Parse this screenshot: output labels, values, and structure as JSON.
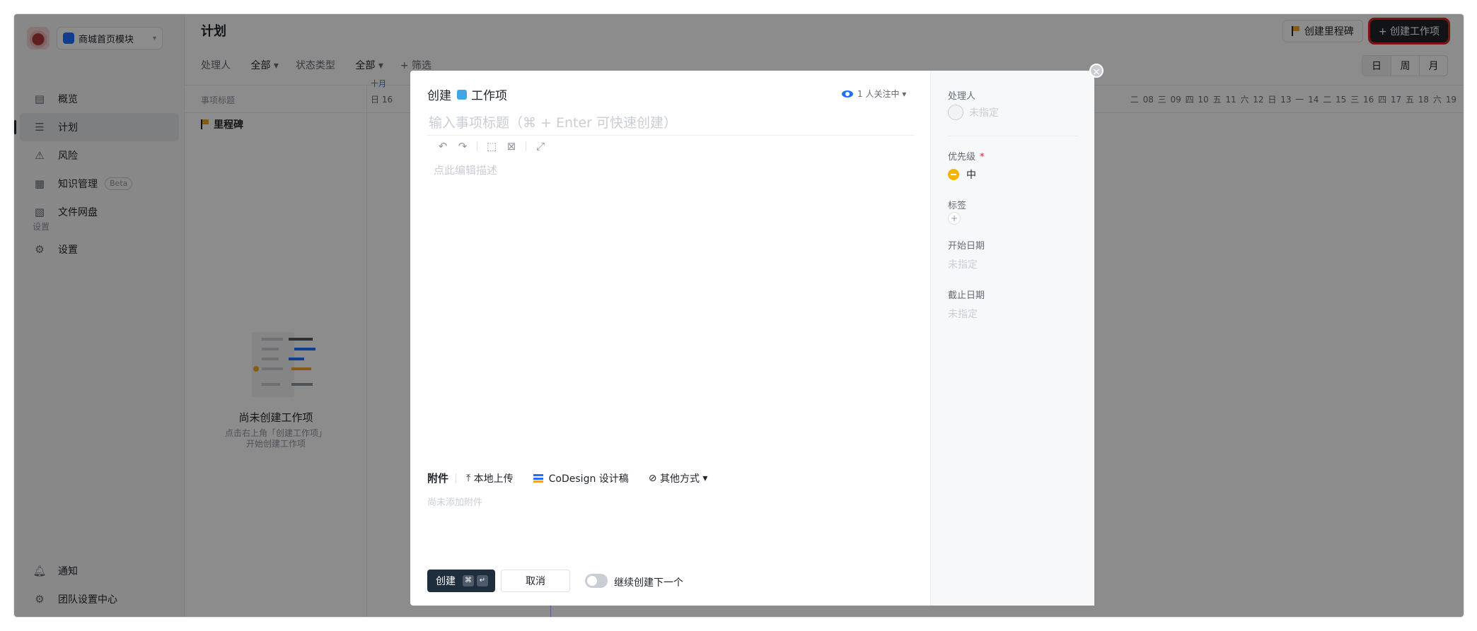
{
  "sidebar": {
    "project_name": "商城首页模块",
    "items": [
      {
        "label": "概览",
        "icon": "overview-icon"
      },
      {
        "label": "计划",
        "icon": "plan-icon"
      },
      {
        "label": "风险",
        "icon": "risk-icon"
      },
      {
        "label": "知识管理",
        "icon": "knowledge-icon",
        "badge": "Beta"
      },
      {
        "label": "文件网盘",
        "icon": "drive-icon"
      }
    ],
    "section_label": "设置",
    "settings_label": "设置",
    "notify_label": "通知",
    "team_settings_label": "团队设置中心"
  },
  "main": {
    "page_title": "计划",
    "create_milestone_label": "创建里程碑",
    "create_work_item_label": "+ 创建工作项",
    "filters": {
      "assignee_label": "处理人",
      "assignee_value": "全部",
      "status_label": "状态类型",
      "status_value": "全部",
      "more_label": "+ 筛选"
    },
    "view_toggle": [
      "日",
      "周",
      "月"
    ],
    "column_title": "事项标题",
    "month_label": "十月",
    "first_day": "日 16",
    "days_right": [
      "二 08",
      "三 09",
      "四 10",
      "五 11",
      "六 12",
      "日 13",
      "一 14",
      "二 15",
      "三 16",
      "四 17",
      "五 18",
      "六 19"
    ],
    "milestone_label": "里程碑",
    "empty_title": "尚未创建工作项",
    "empty_desc": "点击右上角「创建工作项」开始创建工作项"
  },
  "modal": {
    "title_prefix": "创建",
    "title_type": "工作项",
    "watching": "1 人关注中",
    "title_placeholder": "输入事项标题（⌘ + Enter 可快速创建）",
    "desc_placeholder": "点此编辑描述",
    "attach_label": "附件",
    "attach_local": "本地上传",
    "attach_codesign": "CoDesign 设计稿",
    "attach_other": "其他方式",
    "attach_empty": "尚未添加附件",
    "create_label": "创建",
    "cancel_label": "取消",
    "continue_label": "继续创建下一个",
    "props": {
      "assignee_label": "处理人",
      "assignee_value": "未指定",
      "priority_label": "优先级",
      "priority_required": "*",
      "priority_value": "中",
      "tags_label": "标签",
      "start_label": "开始日期",
      "start_value": "未指定",
      "due_label": "截止日期",
      "due_value": "未指定"
    }
  }
}
